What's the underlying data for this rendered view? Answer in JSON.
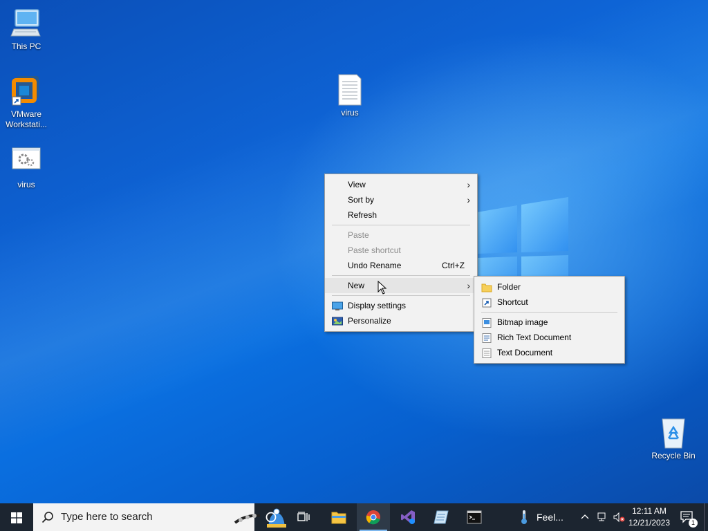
{
  "desktop": {
    "icons": [
      {
        "label": "This PC",
        "icon": "this-pc-icon"
      },
      {
        "label": "VMware Workstati...",
        "icon": "vmware-icon"
      },
      {
        "label": "virus",
        "icon": "batch-file-icon"
      },
      {
        "label": "virus",
        "icon": "text-file-icon"
      },
      {
        "label": "Recycle Bin",
        "icon": "recycle-bin-icon"
      }
    ]
  },
  "context_menu": {
    "items": [
      {
        "label": "View",
        "has_submenu": true
      },
      {
        "label": "Sort by",
        "has_submenu": true
      },
      {
        "label": "Refresh"
      },
      {
        "label": "Paste",
        "disabled": true
      },
      {
        "label": "Paste shortcut",
        "disabled": true
      },
      {
        "label": "Undo Rename",
        "shortcut": "Ctrl+Z"
      },
      {
        "label": "New",
        "has_submenu": true,
        "highlighted": true
      },
      {
        "label": "Display settings",
        "icon": "display-settings-icon"
      },
      {
        "label": "Personalize",
        "icon": "personalize-icon"
      }
    ]
  },
  "new_submenu": {
    "items": [
      {
        "label": "Folder",
        "icon": "folder-icon"
      },
      {
        "label": "Shortcut",
        "icon": "shortcut-icon"
      },
      {
        "label": "Bitmap image",
        "icon": "bitmap-icon"
      },
      {
        "label": "Rich Text Document",
        "icon": "rich-text-icon"
      },
      {
        "label": "Text Document",
        "icon": "text-document-icon"
      }
    ]
  },
  "taskbar": {
    "search_placeholder": "Type here to search",
    "weather_label": "Feel...",
    "time": "12:11 AM",
    "date": "12/21/2023",
    "notification_count": "1",
    "pinned": [
      "file-explorer-icon",
      "chrome-icon",
      "visual-studio-icon",
      "notepad-icon",
      "terminal-icon"
    ]
  },
  "colors": {
    "taskbar_bg": "#1c2530",
    "menu_bg": "#f2f2f2",
    "menu_hover": "#e5e5e5",
    "disabled_text": "#8c8c8c"
  }
}
